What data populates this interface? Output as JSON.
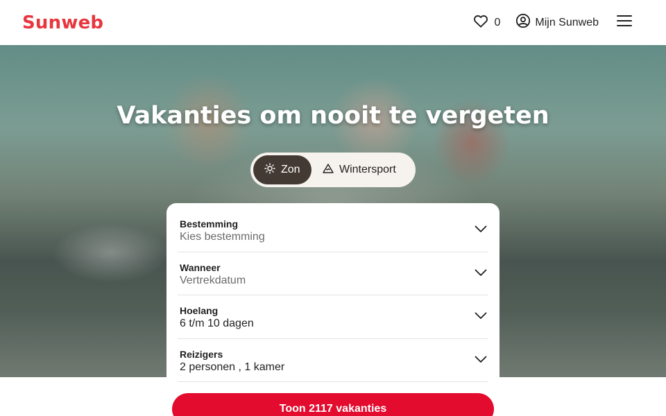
{
  "header": {
    "logo": "Sunweb",
    "favorites_count": "0",
    "account_label": "Mijn Sunweb"
  },
  "hero": {
    "title": "Vakanties om nooit te vergeten",
    "toggle": [
      {
        "label": "Zon",
        "icon": "sun-icon",
        "active": true
      },
      {
        "label": "Wintersport",
        "icon": "mountain-icon",
        "active": false
      }
    ]
  },
  "search": {
    "fields": [
      {
        "label": "Bestemming",
        "value": "Kies bestemming"
      },
      {
        "label": "Wanneer",
        "value": "Vertrekdatum"
      },
      {
        "label": "Hoelang",
        "value": "6 t/m 10 dagen"
      },
      {
        "label": "Reizigers",
        "value": "2 personen , 1 kamer"
      }
    ],
    "submit_label": "Toon 2117 vakanties"
  },
  "colors": {
    "brand": "#e8363f",
    "button": "#e30b2e",
    "toggle_active": "#433a33"
  }
}
